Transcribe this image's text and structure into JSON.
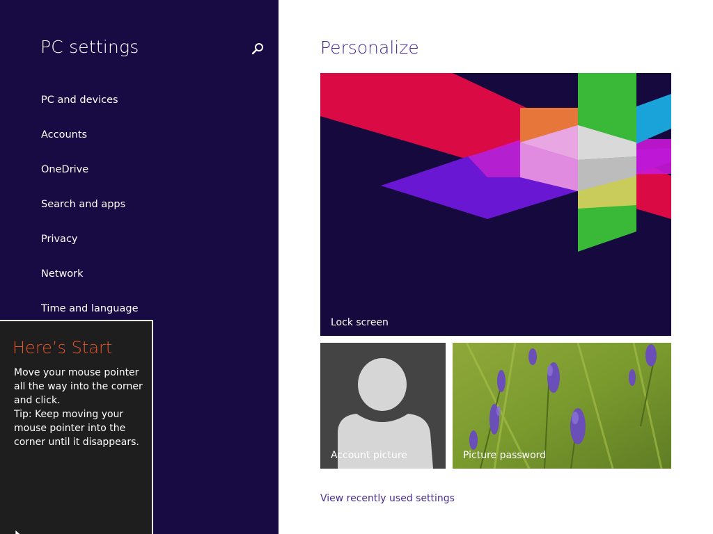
{
  "nav": {
    "title": "PC settings",
    "search_icon": "search-icon",
    "items": [
      {
        "label": "PC and devices"
      },
      {
        "label": "Accounts"
      },
      {
        "label": "OneDrive"
      },
      {
        "label": "Search and apps"
      },
      {
        "label": "Privacy"
      },
      {
        "label": "Network"
      },
      {
        "label": "Time and language"
      }
    ]
  },
  "tip": {
    "title": "Here’s Start",
    "line1": "Move your mouse pointer all the way into the corner and click.",
    "line2": "Tip: Keep moving your mouse pointer into the corner until it disappears."
  },
  "main": {
    "title": "Personalize",
    "tiles": {
      "lock_screen": "Lock screen",
      "account_picture": "Account picture",
      "picture_password": "Picture password"
    },
    "link": "View recently used settings"
  },
  "colors": {
    "nav_background": "#180a42",
    "accent": "#4a2c93",
    "tip_title": "#e8552c",
    "tip_background": "#1e1e1e"
  }
}
